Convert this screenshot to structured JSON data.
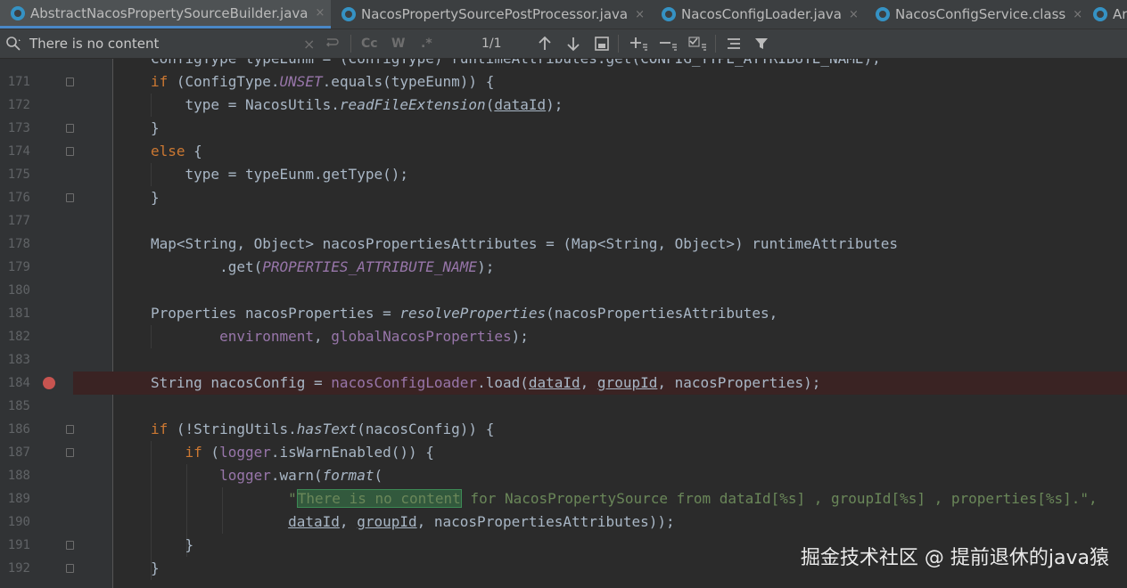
{
  "tabs": [
    {
      "label": "AbstractNacosPropertySourceBuilder.java",
      "close": "×"
    },
    {
      "label": "NacosPropertySourcePostProcessor.java",
      "close": "×"
    },
    {
      "label": "NacosConfigLoader.java",
      "close": "×"
    },
    {
      "label": "NacosConfigService.class",
      "close": "×"
    },
    {
      "label": "Ar"
    }
  ],
  "find": {
    "query": "There is no content",
    "clear": "×",
    "match_case": "Cc",
    "words": "W",
    "regex": ".*",
    "count": "1/1"
  },
  "line_numbers": [
    "171",
    "172",
    "173",
    "174",
    "175",
    "176",
    "177",
    "178",
    "179",
    "180",
    "181",
    "182",
    "183",
    "184",
    "185",
    "186",
    "187",
    "188",
    "189",
    "190",
    "191",
    "192"
  ],
  "code": {
    "l170": "ConfigType typeEunm = (ConfigType) runtimeAttributes.get(CONFIG_TYPE_ATTRIBUTE_NAME);",
    "l171": {
      "kw": "if",
      "a": " (ConfigType.",
      "unset": "UNSET",
      "b": ".equals(typeEunm)) {"
    },
    "l172": {
      "a": "    type = NacosUtils.",
      "fn": "readFileExtension",
      "b": "(",
      "arg": "dataId",
      "c": ");"
    },
    "l173": "}",
    "l174": {
      "kw": "else",
      "a": " {"
    },
    "l175": "    type = typeEunm.getType();",
    "l176": "}",
    "l178": "Map<String, Object> nacosPropertiesAttributes = (Map<String, Object>) runtimeAttributes",
    "l179": {
      "a": "        .get(",
      "const": "PROPERTIES_ATTRIBUTE_NAME",
      "b": ");"
    },
    "l181": {
      "a": "Properties nacosProperties = ",
      "fn": "resolveProperties",
      "b": "(nacosPropertiesAttributes,"
    },
    "l182": {
      "a": "        ",
      "f1": "environment",
      "b": ", ",
      "f2": "globalNacosProperties",
      "c": ");"
    },
    "l184": {
      "a": "String nacosConfig = ",
      "field": "nacosConfigLoader",
      "b": ".load(",
      "arg1": "dataId",
      "c": ", ",
      "arg2": "groupId",
      "d": ", nacosProperties);"
    },
    "l186": {
      "kw": "if",
      "a": " (!StringUtils.",
      "fn": "hasText",
      "b": "(nacosConfig)) {"
    },
    "l187": {
      "a": "    ",
      "kw": "if",
      "b": " (",
      "field": "logger",
      "c": ".isWarnEnabled()) {"
    },
    "l188": {
      "a": "        ",
      "field": "logger",
      "b": ".warn(",
      "fn": "format",
      "c": "("
    },
    "l189": {
      "a": "                \"",
      "hl": "There is no content",
      "b": " for NacosPropertySource from dataId[%s] , groupId[%s] , properties[%s].\","
    },
    "l190": {
      "a": "                ",
      "arg1": "dataId",
      "b": ", ",
      "arg2": "groupId",
      "c": ", nacosPropertiesAttributes));"
    },
    "l191": "    }",
    "l192": "}"
  },
  "watermark": "掘金技术社区 @ 提前退休的java猿",
  "colors": {
    "keyword": "#cc7832",
    "field": "#9876aa",
    "string": "#6a8759",
    "text": "#a9b7c6",
    "breakpoint": "#c75450"
  }
}
